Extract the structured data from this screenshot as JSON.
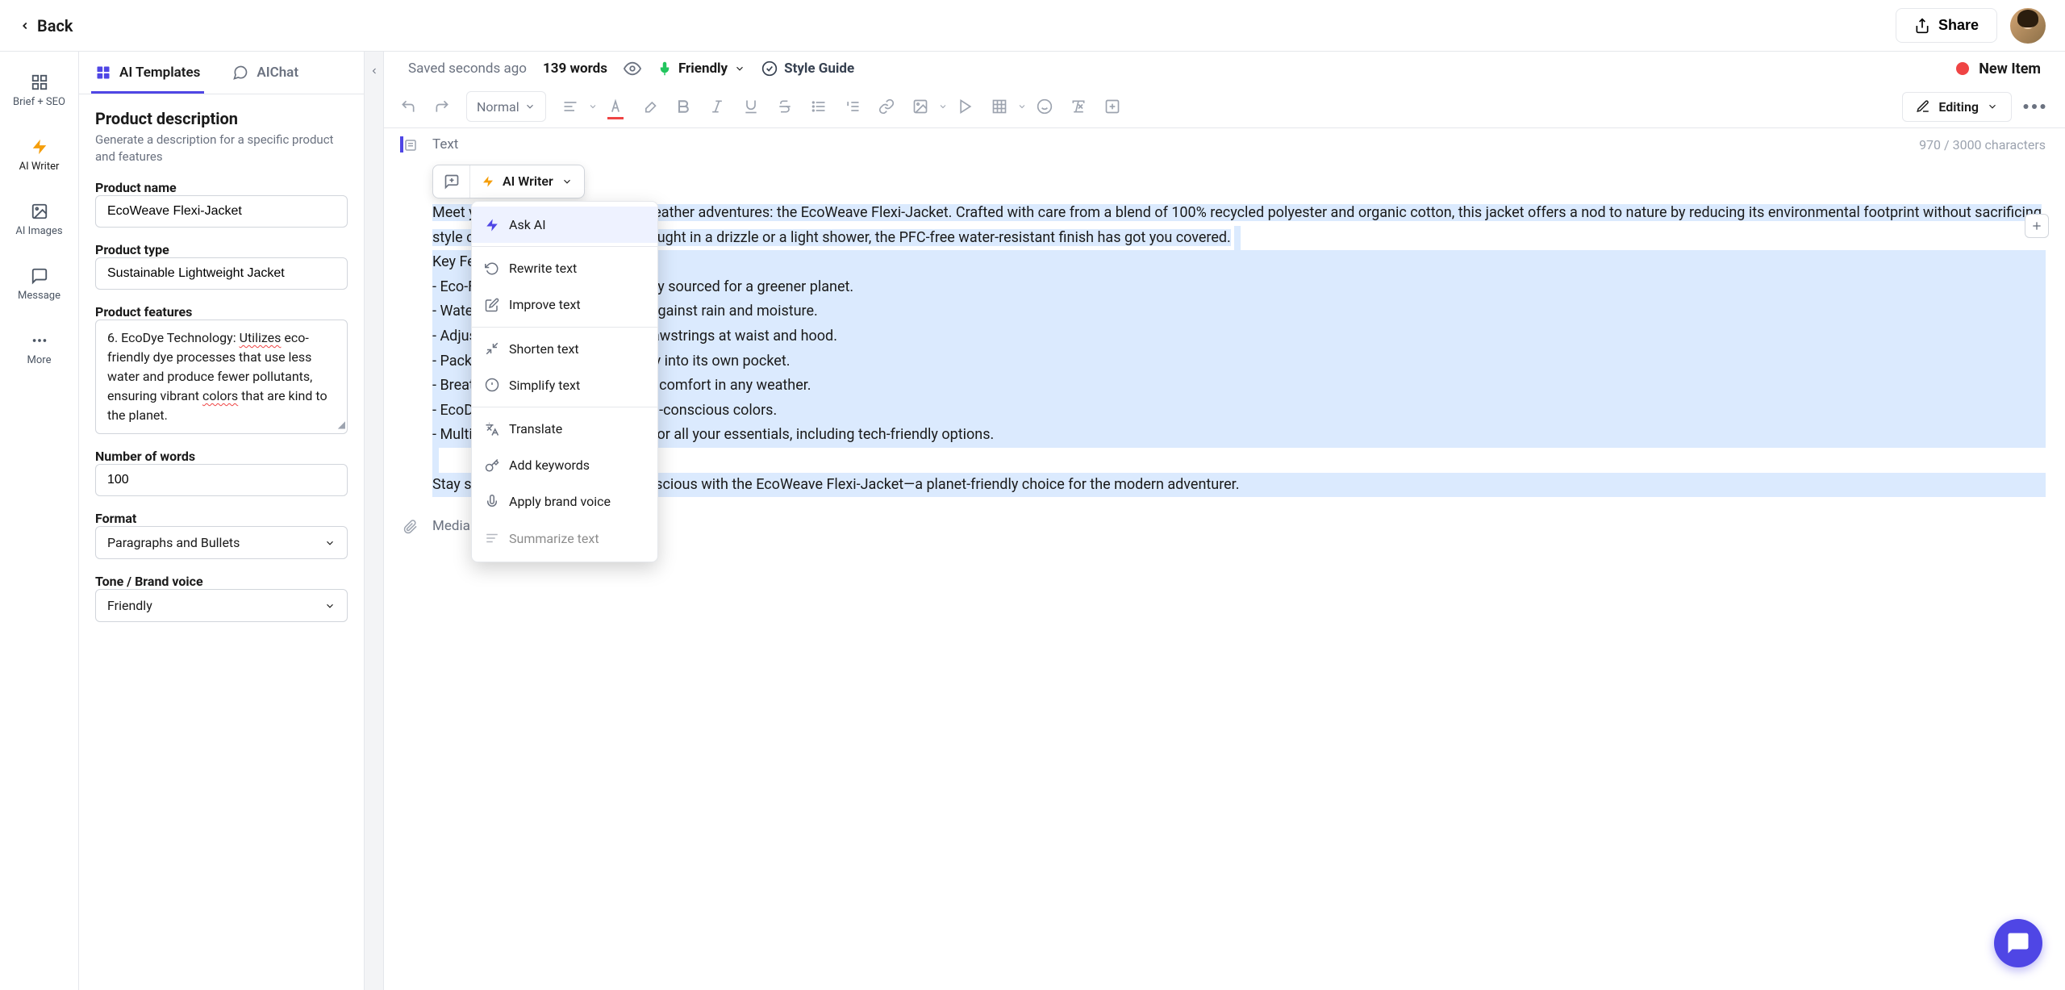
{
  "header": {
    "back": "Back",
    "share": "Share"
  },
  "rail": {
    "brief": "Brief + SEO",
    "writer": "AI Writer",
    "images": "AI Images",
    "message": "Message",
    "more": "More"
  },
  "sidebar_tabs": {
    "templates": "AI Templates",
    "aichat": "AIChat"
  },
  "sidebar": {
    "heading": "Product description",
    "desc": "Generate a description for a specific product and features",
    "product_name_label": "Product name",
    "product_name_value": "EcoWeave Flexi-Jacket",
    "product_type_label": "Product type",
    "product_type_value": "Sustainable Lightweight Jacket",
    "product_features_label": "Product features",
    "product_features_value_prefix": "6. EcoDye Technology: ",
    "product_features_utilizes": "Utilizes",
    "product_features_middle": " eco-friendly dye processes that use less water and produce fewer pollutants, ensuring vibrant ",
    "product_features_colors": "colors",
    "product_features_suffix": " that are kind to the planet.",
    "num_words_label": "Number of words",
    "num_words_value": "100",
    "format_label": "Format",
    "format_value": "Paragraphs and Bullets",
    "tone_label": "Tone / Brand voice",
    "tone_value": "Friendly"
  },
  "editor_header": {
    "saved": "Saved seconds ago",
    "words": "139 words",
    "friendly": "Friendly",
    "style_guide": "Style Guide",
    "status": "New Item"
  },
  "toolbar": {
    "normal": "Normal",
    "editing": "Editing"
  },
  "blocks": {
    "text_label": "Text",
    "char_counter": "970 / 3000 characters",
    "media_label": "Media",
    "intro": "Meet your new go-to layer for all-weather adventures: the EcoWeave Flexi-Jacket. Crafted with care from a blend of 100% recycled polyester and organic cotton, this jacket offers a nod to nature by reducing its environmental footprint without sacrificing style or comfort. Whether you're caught in a drizzle or a light shower, the PFC-free water-resistant finish has got you covered.",
    "key_features": "Key Features:",
    "features": [
      "- Eco-Friendly Materials: Sustainably sourced for a greener planet.",
      "- Water-Resistant Finish: Protects against rain and moisture.",
      "- Adjustable Fit: Customize with drawstrings at waist and hood.",
      "- Packable Design: Folds compactly into its own pocket.",
      "- Breathable Mesh Lining: Great for comfort in any weather.",
      "- EcoDye Technology: Vibrant, earth-conscious colors.",
      "- Multiple Pockets: Handy storage for all your essentials, including tech-friendly options."
    ],
    "outro": "Stay stylish, prepared, and eco-conscious with the EcoWeave Flexi-Jacket—a planet-friendly choice for the modern adventurer."
  },
  "ai_toolbar": {
    "writer": "AI Writer"
  },
  "ai_menu": {
    "ask": "Ask AI",
    "rewrite": "Rewrite text",
    "improve": "Improve text",
    "shorten": "Shorten text",
    "simplify": "Simplify text",
    "translate": "Translate",
    "keywords": "Add keywords",
    "brand_voice": "Apply brand voice",
    "summarize": "Summarize text"
  },
  "colors": {
    "accent": "#4f46e5",
    "status_red": "#ef4444",
    "highlight": "#dbeafe",
    "bolt": "#f59e0b",
    "mic_green": "#22c55e"
  }
}
